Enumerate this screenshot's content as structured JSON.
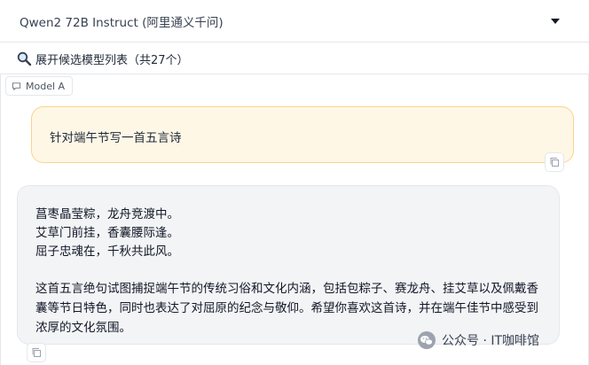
{
  "model_select": {
    "value": "Qwen2 72B Instruct (阿里通义千问)",
    "icon": "chevron-down-icon"
  },
  "model_list": {
    "label": "展开候选模型列表（共27个）",
    "icon": "search-icon"
  },
  "chat": {
    "model_label": "Model A",
    "user_message": "针对端午节写一首五言诗",
    "assistant": {
      "poem_lines": [
        "菖枣晶莹粽，龙舟竞渡中。",
        "艾草门前挂，香囊腰际逢。",
        "屈子忠魂在，千秋共此风。"
      ],
      "explanation": "这首五言绝句试图捕捉端午节的传统习俗和文化内涵，包括包粽子、赛龙舟、挂艾草以及佩戴香囊等节日特色，同时也表达了对屈原的纪念与敬仰。希望你喜欢这首诗，并在端午佳节中感受到浓厚的文化氛围。"
    },
    "copy_icon": "copy-icon"
  },
  "watermark": {
    "text": "公众号 · IT咖啡馆",
    "icon": "wechat-icon"
  },
  "colors": {
    "user_bubble_bg": "#fff7e6",
    "user_bubble_border": "#fbd38d",
    "assistant_bubble_bg": "#f3f4f6"
  }
}
